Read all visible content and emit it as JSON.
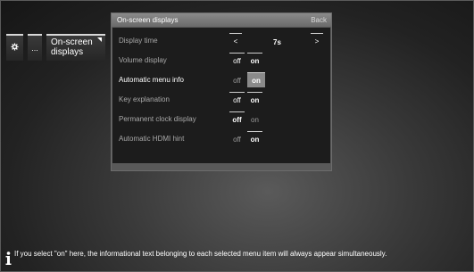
{
  "breadcrumb": {
    "gear_icon": "gear-icon",
    "dots": "...",
    "section_label": "On-screen displays"
  },
  "panel": {
    "title": "On-screen displays",
    "back_label": "Back",
    "rows": [
      {
        "label": "Display time",
        "type": "stepper",
        "left": "<",
        "value": "7s",
        "right": ">"
      },
      {
        "label": "Volume display",
        "type": "toggle",
        "off": "off",
        "on": "on",
        "selected": "on"
      },
      {
        "label": "Automatic menu info",
        "type": "toggle",
        "off": "off",
        "on": "on",
        "selected": "on",
        "focused": true
      },
      {
        "label": "Key explanation",
        "type": "toggle",
        "off": "off",
        "on": "on",
        "selected": "off"
      },
      {
        "label": "Permanent clock display",
        "type": "toggle",
        "off": "off",
        "on": "on",
        "selected": "off"
      },
      {
        "label": "Automatic HDMI hint",
        "type": "toggle",
        "off": "off",
        "on": "on",
        "selected": "on"
      }
    ]
  },
  "hint": {
    "icon": "info-icon",
    "text": "If you select \"on\" here, the informational text belonging to each selected menu item will always appear simultaneously."
  }
}
